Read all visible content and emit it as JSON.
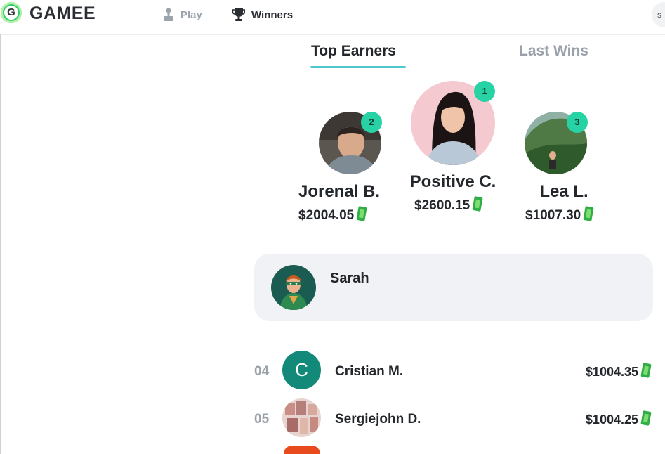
{
  "brand": {
    "logo_letter": "G",
    "name": "GAMEE",
    "color": "#2ecc71"
  },
  "nav": {
    "play_label": "Play",
    "winners_label": "Winners",
    "search_partial": "s"
  },
  "tabs": [
    {
      "label": "Top Earners",
      "active": true
    },
    {
      "label": "Last Wins",
      "active": false
    }
  ],
  "podium": [
    {
      "rank": "2",
      "name": "Jorenal B.",
      "amount": "$2004.05",
      "icon": "cash-icon"
    },
    {
      "rank": "1",
      "name": "Positive C.",
      "amount": "$2600.15",
      "icon": "cash-icon"
    },
    {
      "rank": "3",
      "name": "Lea L.",
      "amount": "$1007.30",
      "icon": "cash-icon"
    }
  ],
  "current_user": {
    "name": "Sarah",
    "avatar": "superhero-avatar"
  },
  "leaderboard": [
    {
      "rank": "04",
      "name": "Cristian M.",
      "amount": "$1004.35",
      "avatar_letter": "C"
    },
    {
      "rank": "05",
      "name": "Sergiejohn D.",
      "amount": "$1004.25",
      "avatar_letter": ""
    }
  ],
  "colors": {
    "accent": "#27d3a5",
    "tab_underline": "#4ec7d0",
    "muted": "#9aa1aa",
    "card_bg": "#f1f2f5"
  }
}
